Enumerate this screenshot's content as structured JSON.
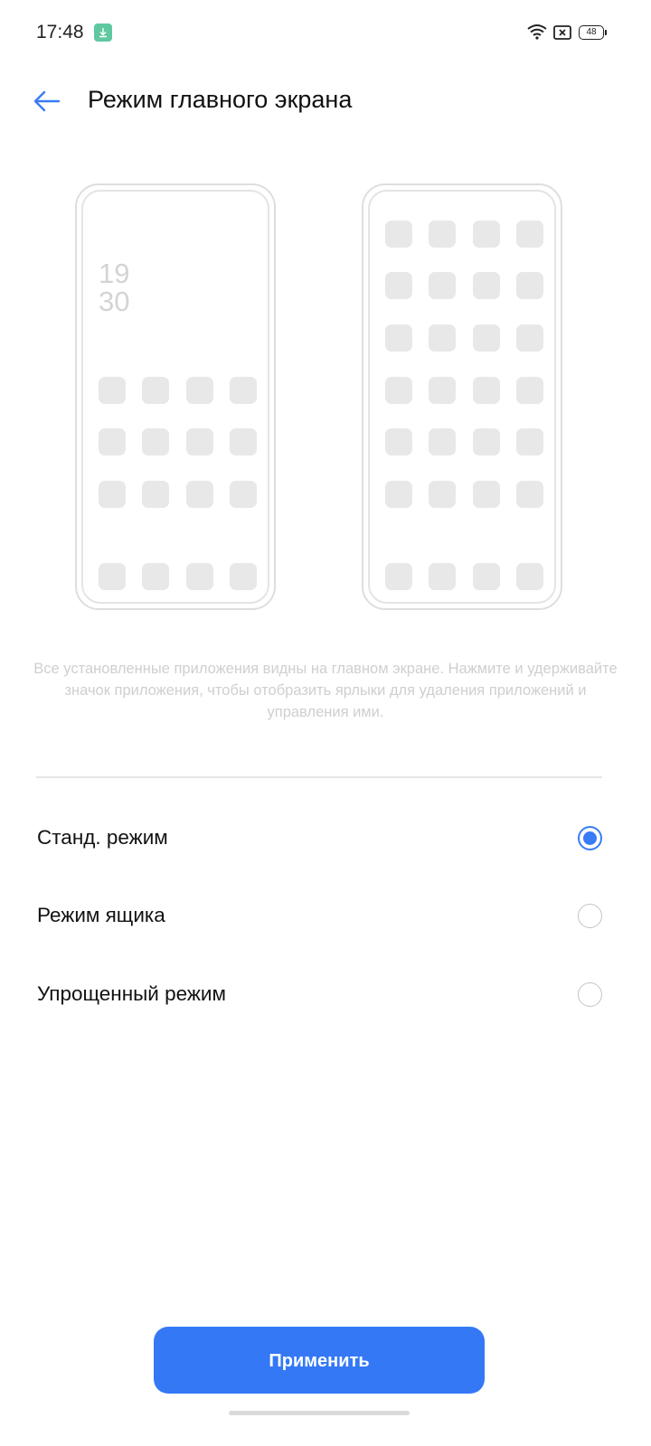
{
  "status_bar": {
    "time": "17:48",
    "battery": "48"
  },
  "header": {
    "title": "Режим главного экрана"
  },
  "preview": {
    "standard_clock_hour": "19",
    "standard_clock_minute": "30"
  },
  "description": "Все установленные приложения видны на главном экране. Нажмите и удерживайте значок приложения, чтобы отобразить ярлыки для удаления приложений и управления ими.",
  "options": [
    {
      "label": "Станд. режим",
      "selected": true
    },
    {
      "label": "Режим ящика",
      "selected": false
    },
    {
      "label": "Упрощенный режим",
      "selected": false
    }
  ],
  "apply_button": {
    "label": "Применить"
  },
  "colors": {
    "accent": "#3478f6",
    "radio_checked": "#3a7bf6",
    "badge": "#5fc8a0"
  }
}
